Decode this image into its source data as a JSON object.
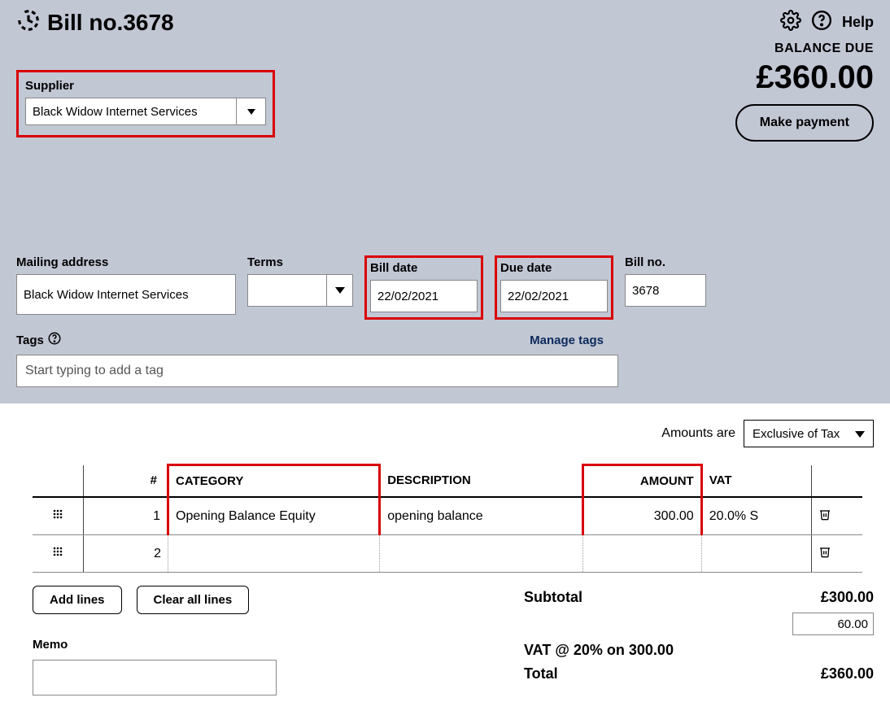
{
  "header": {
    "title": "Bill no.3678",
    "help_label": "Help"
  },
  "balance": {
    "label": "BALANCE DUE",
    "amount": "£360.00",
    "make_payment_label": "Make payment"
  },
  "supplier": {
    "label": "Supplier",
    "value": "Black Widow Internet Services"
  },
  "fields": {
    "mailing_label": "Mailing address",
    "mailing_value": "Black Widow Internet Services",
    "terms_label": "Terms",
    "terms_value": "",
    "bill_date_label": "Bill date",
    "bill_date_value": "22/02/2021",
    "due_date_label": "Due date",
    "due_date_value": "22/02/2021",
    "bill_no_label": "Bill no.",
    "bill_no_value": "3678"
  },
  "tags": {
    "label": "Tags",
    "placeholder": "Start typing to add a tag",
    "manage_label": "Manage tags"
  },
  "amounts": {
    "label": "Amounts are",
    "value": "Exclusive of Tax"
  },
  "columns": {
    "num": "#",
    "category": "CATEGORY",
    "description": "DESCRIPTION",
    "amount": "AMOUNT",
    "vat": "VAT"
  },
  "lines": [
    {
      "num": "1",
      "category": "Opening Balance Equity",
      "description": "opening balance",
      "amount": "300.00",
      "vat": "20.0% S"
    },
    {
      "num": "2",
      "category": "",
      "description": "",
      "amount": "",
      "vat": ""
    }
  ],
  "buttons": {
    "add_lines": "Add lines",
    "clear_lines": "Clear all lines"
  },
  "memo": {
    "label": "Memo",
    "value": ""
  },
  "totals": {
    "subtotal_label": "Subtotal",
    "subtotal_value": "£300.00",
    "vat_label": "VAT @ 20% on 300.00",
    "vat_value": "60.00",
    "total_label": "Total",
    "total_value": "£360.00"
  }
}
